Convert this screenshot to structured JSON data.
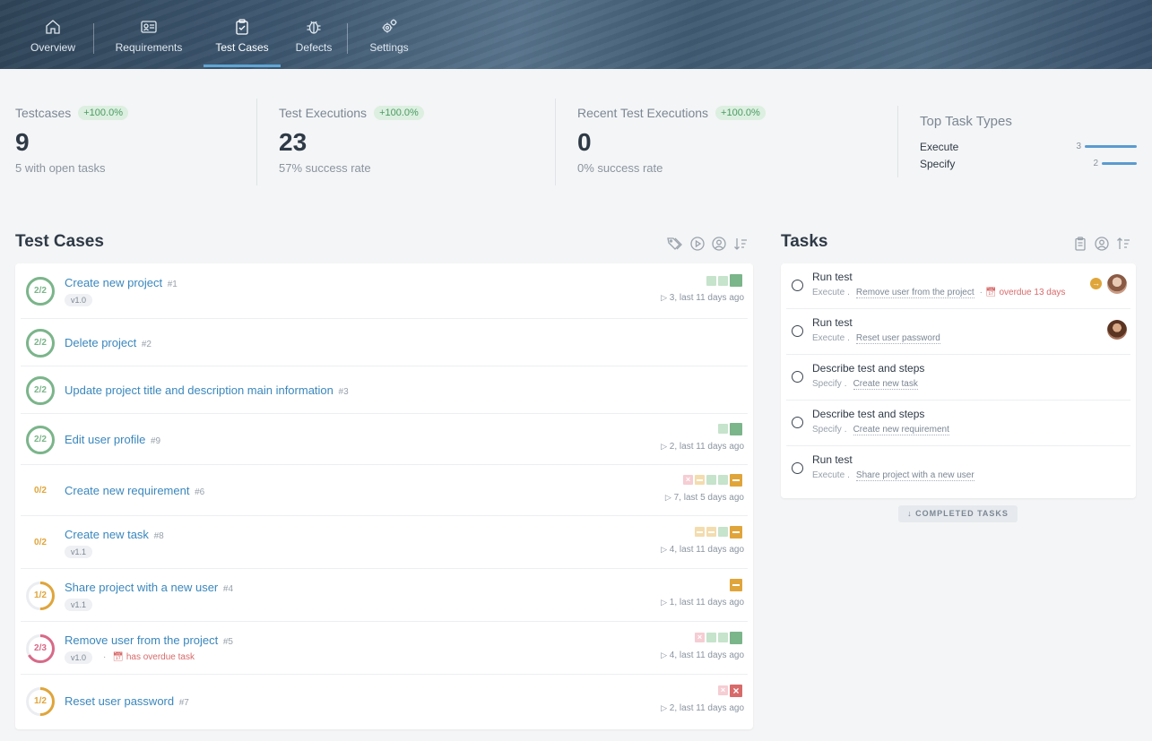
{
  "nav": {
    "items": [
      {
        "label": "Overview",
        "icon": "home-icon"
      },
      {
        "label": "Requirements",
        "icon": "id-card-icon"
      },
      {
        "label": "Test Cases",
        "icon": "clipboard-check-icon",
        "active": true
      },
      {
        "label": "Defects",
        "icon": "bug-icon"
      },
      {
        "label": "Settings",
        "icon": "gears-icon"
      }
    ]
  },
  "stats": {
    "testcases": {
      "label": "Testcases",
      "badge": "+100.0%",
      "value": "9",
      "sub": "5 with open tasks"
    },
    "executions": {
      "label": "Test Executions",
      "badge": "+100.0%",
      "value": "23",
      "sub": "57% success rate"
    },
    "recent": {
      "label": "Recent Test Executions",
      "badge": "+100.0%",
      "value": "0",
      "sub": "0% success rate"
    }
  },
  "top_task_types": {
    "title": "Top Task Types",
    "items": [
      {
        "label": "Execute",
        "count": "3",
        "fraction": 1.0
      },
      {
        "label": "Specify",
        "count": "2",
        "fraction": 0.667
      }
    ]
  },
  "test_cases": {
    "title": "Test Cases",
    "toolbar_icons": [
      "tag-icon",
      "play-circle-icon",
      "user-circle-icon",
      "sort-desc-icon"
    ],
    "colors": {
      "green": "#7bb58a",
      "light_green": "#c6e3cc",
      "orange": "#e0a53a",
      "light_orange": "#f3dcae",
      "red": "#d86a6a",
      "light_red": "#f5cdd3"
    },
    "rows": [
      {
        "progress": "2/2",
        "fraction": 1.0,
        "color": "#7bb58a",
        "title": "Create new project",
        "num": "#1",
        "version": "v1.0",
        "squares": [
          "lg",
          "lg",
          "G"
        ],
        "runs": "3, last 11 days ago"
      },
      {
        "progress": "2/2",
        "fraction": 1.0,
        "color": "#7bb58a",
        "title": "Delete project",
        "num": "#2"
      },
      {
        "progress": "2/2",
        "fraction": 1.0,
        "color": "#7bb58a",
        "title": "Update project title and description main information",
        "num": "#3"
      },
      {
        "progress": "2/2",
        "fraction": 1.0,
        "color": "#7bb58a",
        "title": "Edit user profile",
        "num": "#9",
        "squares": [
          "lg",
          "G"
        ],
        "runs": "2, last 11 days ago"
      },
      {
        "progress": "0/2",
        "fraction": 0.0,
        "color": "#e0a53a",
        "title": "Create new requirement",
        "num": "#6",
        "squares": [
          "lr",
          "lo",
          "lg",
          "lg",
          "O"
        ],
        "runs": "7, last 5 days ago"
      },
      {
        "progress": "0/2",
        "fraction": 0.0,
        "color": "#e0a53a",
        "title": "Create new task",
        "num": "#8",
        "version": "v1.1",
        "squares": [
          "lo",
          "lo",
          "lg",
          "O"
        ],
        "runs": "4, last 11 days ago"
      },
      {
        "progress": "1/2",
        "fraction": 0.5,
        "color": "#e0a53a",
        "title": "Share project with a new user",
        "num": "#4",
        "version": "v1.1",
        "squares": [
          "O"
        ],
        "runs": "1, last 11 days ago"
      },
      {
        "progress": "2/3",
        "fraction": 0.667,
        "color": "#d86a88",
        "title": "Remove user from the project",
        "num": "#5",
        "version": "v1.0",
        "overdue": "has overdue task",
        "squares": [
          "lr",
          "lg",
          "lg",
          "G"
        ],
        "runs": "4, last 11 days ago"
      },
      {
        "progress": "1/2",
        "fraction": 0.5,
        "color": "#e0a53a",
        "title": "Reset user password",
        "num": "#7",
        "squares": [
          "lr",
          "R"
        ],
        "runs": "2, last 11 days ago"
      }
    ]
  },
  "tasks": {
    "title": "Tasks",
    "toolbar_icons": [
      "clipboard-icon",
      "user-circle-icon",
      "sort-asc-icon"
    ],
    "rows": [
      {
        "title": "Run test",
        "type": "Execute",
        "link": "Remove user from the project",
        "overdue": "overdue 13 days",
        "avatar": true,
        "arrow": true
      },
      {
        "title": "Run test",
        "type": "Execute",
        "link": "Reset user password",
        "avatar": true
      },
      {
        "title": "Describe test and steps",
        "type": "Specify",
        "link": "Create new task"
      },
      {
        "title": "Describe test and steps",
        "type": "Specify",
        "link": "Create new requirement"
      },
      {
        "title": "Run test",
        "type": "Execute",
        "link": "Share project with a new user"
      }
    ],
    "completed_label": "COMPLETED TASKS"
  }
}
